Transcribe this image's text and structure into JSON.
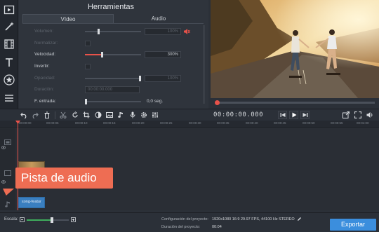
{
  "tools_panel": {
    "title": "Herramientas",
    "tabs": [
      "Vídeo",
      "Audio"
    ],
    "properties": {
      "volumen": {
        "label": "Volumen:",
        "value": "100%"
      },
      "normalizar": {
        "label": "Normalizar:"
      },
      "velocidad": {
        "label": "Velocidad:",
        "value": "300%"
      },
      "invertir": {
        "label": "Invertir:"
      },
      "opacidad": {
        "label": "Opacidad:",
        "value": "100%"
      },
      "duracion": {
        "label": "Duración:",
        "value": "00:00:00.000"
      },
      "entrada": {
        "label": "F. entrada:",
        "value": "0,0 seg."
      }
    }
  },
  "preview": {
    "timecode": "00:00:00.000",
    "playback_progress": 0.0
  },
  "ruler": {
    "ticks": [
      "00:00:00",
      "00:00:05",
      "00:00:10",
      "00:00:15",
      "00:00:20",
      "00:00:25",
      "00:00:30",
      "00:00:35",
      "00:00:40",
      "00:00:45",
      "00:00:50",
      "00:00:55",
      "00:01:00"
    ]
  },
  "timeline": {
    "audio_clip_label": "song-featur",
    "callout": "Pista de audio"
  },
  "bottom": {
    "scale_label": "Escala:",
    "config_label": "Configuración del proyecto:",
    "config_value": "1920x1080 16:9 29.97 FPS, 44100 Hz STEREO",
    "duration_label": "Duración del proyecto:",
    "duration_value": "00:04",
    "export_label": "Exportar"
  },
  "colors": {
    "accent": "#e8524a",
    "export": "#3b8edd",
    "callout": "#ee6d53",
    "scale": "#3fae5c"
  },
  "icons": {
    "left_tools": [
      "media-icon",
      "magic-wand-icon",
      "film-icon",
      "text-icon",
      "star-icon",
      "list-icon"
    ],
    "toolbar": [
      "undo-icon",
      "redo-icon",
      "trash-icon",
      "cut-icon",
      "rotate-icon",
      "crop-icon",
      "color-icon",
      "image-icon",
      "audio-icon",
      "mic-icon",
      "settings-icon",
      "equalizer-icon"
    ]
  }
}
